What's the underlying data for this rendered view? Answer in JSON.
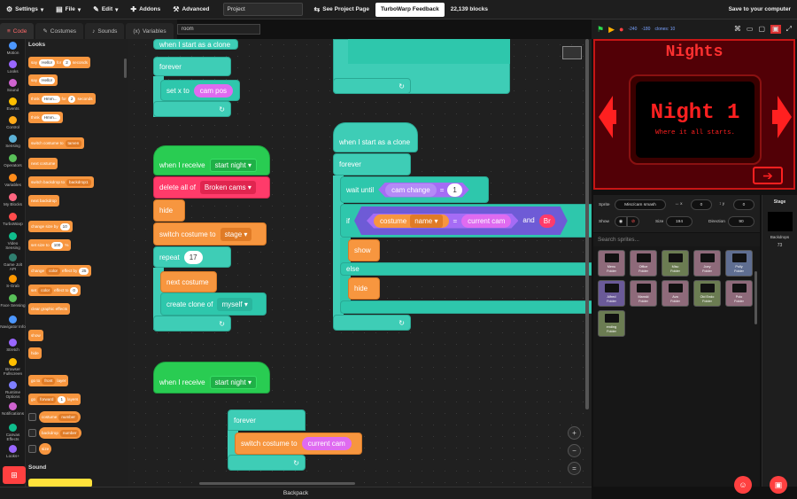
{
  "menubar": {
    "settings": "Settings",
    "file": "File",
    "edit": "Edit",
    "addons": "Addons",
    "advanced": "Advanced",
    "project_title": "Project",
    "see_project_page": "See Project Page",
    "feedback": "TurboWarp Feedback",
    "block_count": "22,139 blocks",
    "save": "Save to your computer"
  },
  "tabs": {
    "code": "Code",
    "costumes": "Costumes",
    "sounds": "Sounds",
    "variables": "Variables"
  },
  "room_field": "room",
  "categories": [
    {
      "label": "Motion",
      "color": "#4c97ff"
    },
    {
      "label": "Looks",
      "color": "#9966ff"
    },
    {
      "label": "Sound",
      "color": "#cf63cf"
    },
    {
      "label": "Events",
      "color": "#ffbf00"
    },
    {
      "label": "Control",
      "color": "#ffab19"
    },
    {
      "label": "Sensing",
      "color": "#5cb1d6"
    },
    {
      "label": "Operators",
      "color": "#59c059"
    },
    {
      "label": "Variables",
      "color": "#ff8c1a"
    },
    {
      "label": "My Blocks",
      "color": "#ff6680"
    },
    {
      "label": "TurboWarp",
      "color": "#ff4c4c"
    },
    {
      "label": "Video Sensing",
      "color": "#0fbd8c"
    },
    {
      "label": "Game Jolt API",
      "color": "#2f7f6f"
    },
    {
      "label": "S-Grab",
      "color": "#ff9900"
    },
    {
      "label": "Face Sensing",
      "color": "#59c059"
    },
    {
      "label": "Navigator Info",
      "color": "#4c97ff"
    },
    {
      "label": "Stretch",
      "color": "#9966ff"
    },
    {
      "label": "Browser Fullscreen",
      "color": "#ffbf00"
    },
    {
      "label": "Runtime Options",
      "color": "#7f7fff"
    },
    {
      "label": "Notifications",
      "color": "#cf63cf"
    },
    {
      "label": "Canvas Effects",
      "color": "#0fbd8c"
    },
    {
      "label": "Looks+",
      "color": "#9966ff"
    }
  ],
  "palette": {
    "looks_title": "Looks",
    "sound_title": "Sound",
    "blocks": [
      {
        "text": "say",
        "pill": "Hello!",
        "mid": "for",
        "pill2": "2",
        "end": "seconds"
      },
      {
        "text": "say",
        "pill": "Hello!"
      },
      {
        "text": "think",
        "pill": "Hmm...",
        "mid": "for",
        "pill2": "2",
        "end": "seconds"
      },
      {
        "text": "think",
        "pill": "Hmm..."
      },
      {
        "text": "switch costume to",
        "dd": "tarven"
      },
      {
        "text": "next costume"
      },
      {
        "text": "switch backdrop to",
        "dd": "backdrop1"
      },
      {
        "text": "next backdrop"
      },
      {
        "text": "change size by",
        "pill": "10"
      },
      {
        "text": "set size to",
        "pill": "100",
        "end": "%"
      },
      {
        "text": "change",
        "dd": "color",
        "mid": "effect by",
        "pill2": "25"
      },
      {
        "text": "set",
        "dd": "color",
        "mid": "effect to",
        "pill2": "0"
      },
      {
        "text": "clear graphic effects"
      },
      {
        "text": "show"
      },
      {
        "text": "hide"
      },
      {
        "text": "go to",
        "dd": "front",
        "end": "layer"
      },
      {
        "text": "go",
        "dd": "forward",
        "pill2": "1",
        "end": "layers"
      },
      {
        "text": "costume",
        "dd": "number"
      },
      {
        "text": "backdrop",
        "dd": "number"
      },
      {
        "text": "size"
      }
    ]
  },
  "scripts": {
    "s1": {
      "hat": "when I start as a clone",
      "forever": "forever",
      "set_x": "set x to",
      "cam_pos": "cam pos"
    },
    "s2": {
      "hat": "when I receive",
      "msg": "start night",
      "delete": "delete all of",
      "list": "Broken cams",
      "hide": "hide",
      "switch": "switch costume to",
      "costume": "stage",
      "repeat": "repeat",
      "times": "17",
      "next": "next costume",
      "clone": "create clone of",
      "target": "myself"
    },
    "s3": {
      "hat": "when I receive",
      "msg": "start night"
    },
    "s4": {
      "forever": "forever",
      "switch": "switch costume to",
      "reporter": "current cam"
    },
    "s5": {
      "hat": "when I start as a clone",
      "forever": "forever",
      "wait_until": "wait until",
      "cam_change": "cam change",
      "eq": "=",
      "one": "1",
      "if": "if",
      "costume": "costume",
      "name": "name",
      "current_cam": "current cam",
      "and": "and",
      "br": "Br",
      "show": "show",
      "else": "else",
      "hide": "hide"
    }
  },
  "stage_header": {
    "mouse_x": "-240",
    "mouse_y": "-180",
    "clones": "clones: 10"
  },
  "stage": {
    "title": "Nights",
    "night": "Night 1",
    "subtitle": "Where it all starts.",
    "border_color": "#c81515"
  },
  "sprite_info": {
    "sprite_label": "Sprite",
    "sprite_name": "Misc/cam smash",
    "x_val": "0",
    "y_val": "0",
    "show_label": "Show",
    "size_label": "Size",
    "size_val": "194",
    "direction_label": "Direction",
    "direction_val": "90"
  },
  "search_placeholder": "Search sprites...",
  "sprites": [
    {
      "name": "Menu",
      "sub": "Folder",
      "color": "#8e6a7a"
    },
    {
      "name": "Office",
      "sub": "Folder",
      "color": "#8e6a7a"
    },
    {
      "name": "Misc",
      "sub": "Folder",
      "color": "#6b7c52"
    },
    {
      "name": "Joey",
      "sub": "Folder",
      "color": "#8e6a7a"
    },
    {
      "name": "Polly",
      "sub": "Folder",
      "color": "#5f6e91"
    },
    {
      "name": "Alfred",
      "sub": "Folder",
      "color": "#6a5a98"
    },
    {
      "name": "Manski",
      "sub": "Folder",
      "color": "#8e6a7a"
    },
    {
      "name": "Ava",
      "sub": "Folder",
      "color": "#8e6a7a"
    },
    {
      "name": "Old Endo",
      "sub": "Folder",
      "color": "#6b7c52"
    },
    {
      "name": "Polo",
      "sub": "Folder",
      "color": "#8e6a7a"
    },
    {
      "name": "ending",
      "sub": "Folder",
      "color": "#6b7c52"
    }
  ],
  "stage_panel": {
    "title": "Stage",
    "backdrops_label": "Backdrops",
    "backdrops_count": "73"
  },
  "backpack": "Backpack"
}
